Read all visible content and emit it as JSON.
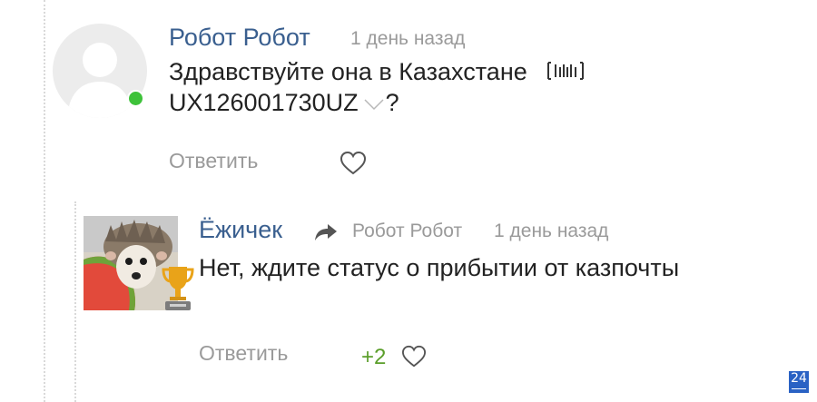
{
  "comments": [
    {
      "author": "Робот Робот",
      "time": "1 день назад",
      "text_line1": "Здравствуйте она в Казахстане",
      "tracking_number": "UX126001730UZ",
      "text_end": "?",
      "reply_label": "Ответить",
      "online": true
    },
    {
      "author": "Ёжичек",
      "reply_to": "Робот Робот",
      "time": "1 день назад",
      "text": "Нет, ждите статус о прибытии от казпочты",
      "reply_label": "Ответить",
      "rating": "+2"
    }
  ],
  "badge": "24",
  "colors": {
    "author": "#3a5f8f",
    "muted": "#9a9a9a",
    "online": "#3ec23a",
    "rating": "#5a9e2a",
    "badge": "#2a62c4"
  },
  "icons": [
    "user-silhouette-icon",
    "barcode-icon",
    "chevron-down-icon",
    "heart-icon",
    "reply-arrow-icon",
    "trophy-icon"
  ]
}
